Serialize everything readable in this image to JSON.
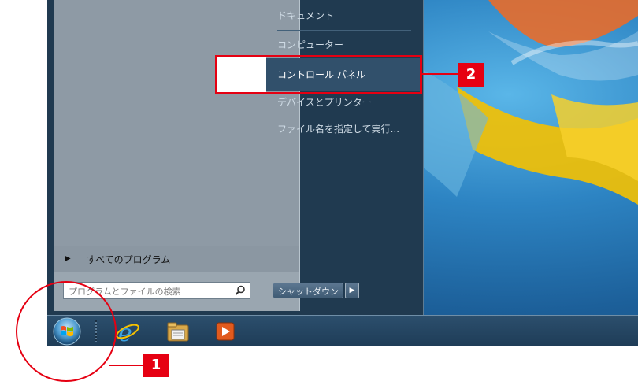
{
  "start_menu": {
    "right_items": [
      {
        "label": "ドキュメント"
      },
      {
        "label": "コンピューター"
      },
      {
        "label": "コントロール パネル",
        "highlighted": true
      },
      {
        "label": "デバイスとプリンター"
      },
      {
        "label": "ファイル名を指定して実行..."
      }
    ],
    "all_programs_label": "すべてのプログラム",
    "search_placeholder": "プログラムとファイルの検索",
    "shutdown_label": "シャットダウン"
  },
  "taskbar": {
    "icons": [
      "windows-start-orb-icon",
      "internet-explorer-icon",
      "file-explorer-icon",
      "media-player-icon"
    ]
  },
  "annotations": {
    "step1": "1",
    "step2": "2",
    "color": "#e50012"
  }
}
